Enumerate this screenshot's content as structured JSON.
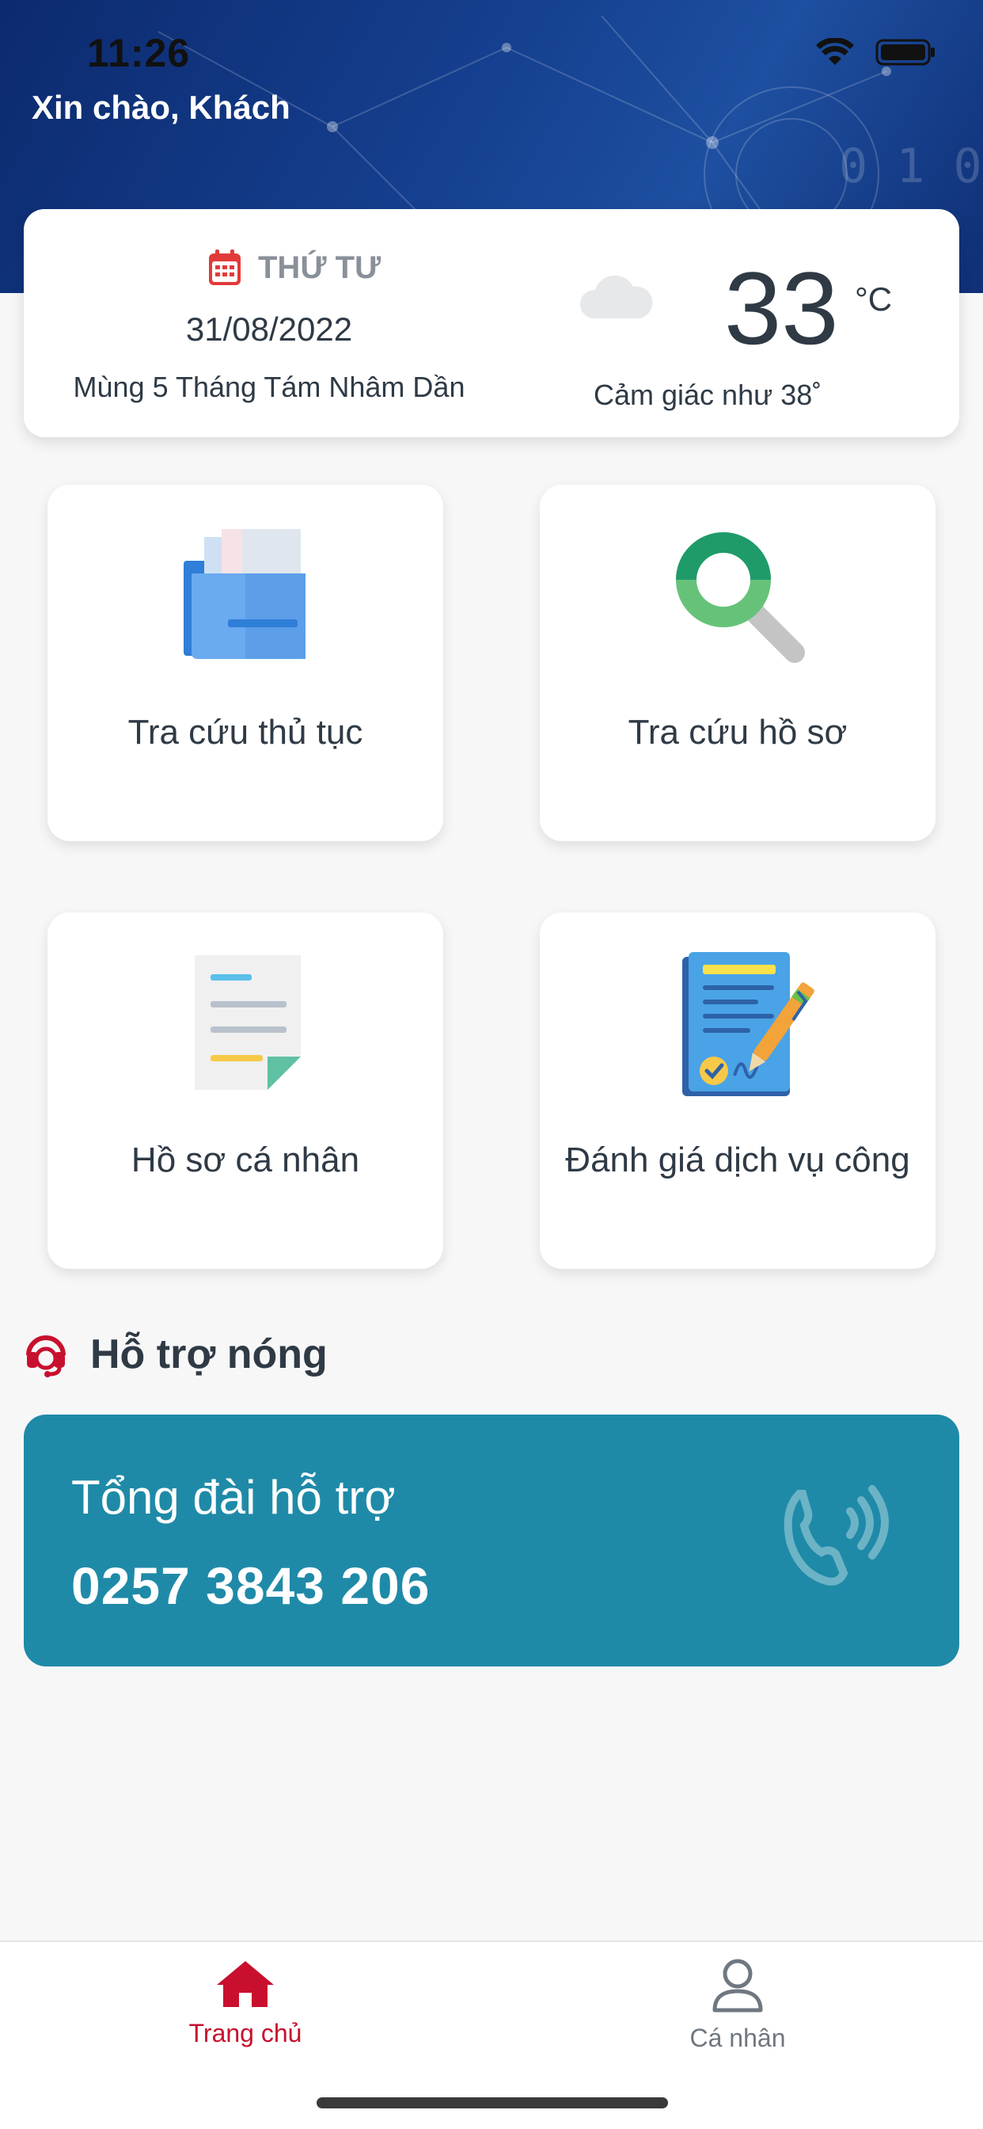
{
  "status_bar": {
    "time": "11:26"
  },
  "header": {
    "greeting": "Xin chào, Khách"
  },
  "info_card": {
    "weekday": "THỨ TƯ",
    "date": "31/08/2022",
    "lunar_date": "Mùng 5 Tháng Tám Nhâm Dần",
    "temperature": "33",
    "temperature_unit": "°C",
    "feels_like": "Cảm giác như 38˚",
    "weather_icon": "cloud-icon"
  },
  "tiles": [
    {
      "label": "Tra cứu thủ tục",
      "icon": "folder-documents-icon"
    },
    {
      "label": "Tra cứu hồ sơ",
      "icon": "magnifier-icon"
    },
    {
      "label": "Hồ sơ cá nhân",
      "icon": "document-icon"
    },
    {
      "label": "Đánh giá dịch vụ công",
      "icon": "signed-document-icon"
    }
  ],
  "hotline": {
    "section_title": "Hỗ trợ nóng",
    "label": "Tổng đài hỗ trợ",
    "number": "0257 3843 206"
  },
  "bottom_nav": {
    "items": [
      {
        "label": "Trang chủ",
        "icon": "home-icon",
        "active": true
      },
      {
        "label": "Cá nhân",
        "icon": "person-icon",
        "active": false
      }
    ]
  },
  "colors": {
    "accent_red": "#c8102e",
    "hotline_bg": "#1f8aa8",
    "header_blue": "#153f8f"
  }
}
